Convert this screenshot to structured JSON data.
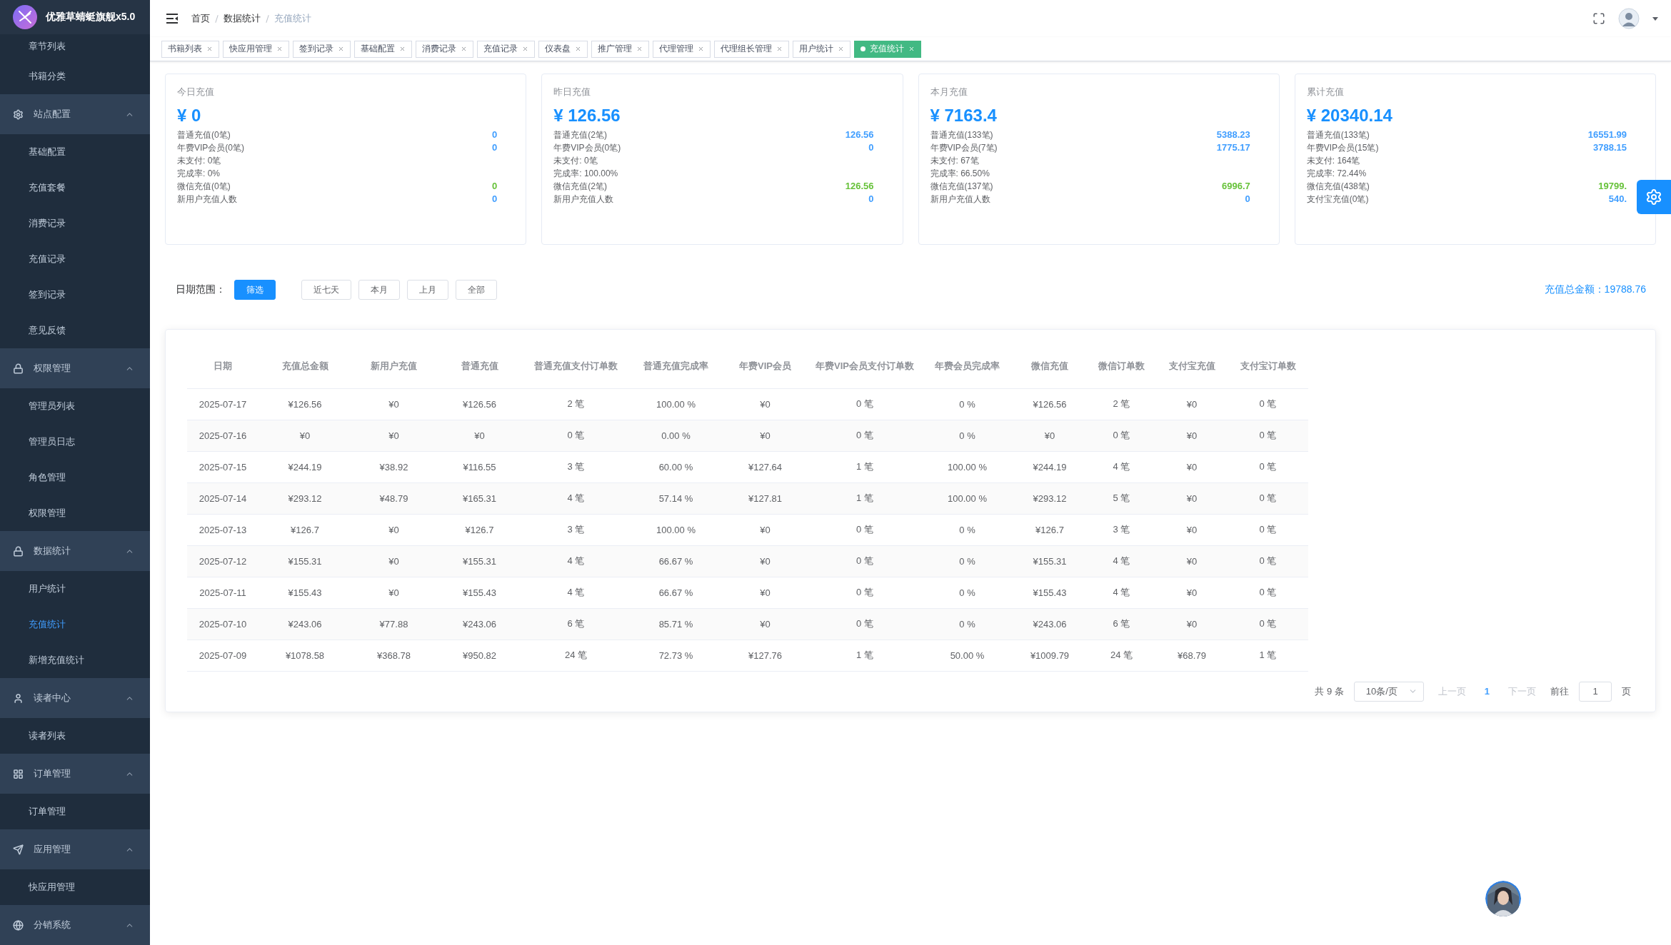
{
  "sidebar": {
    "logo_title": "优雅草蜻蜓旗舰x5.0",
    "menu": [
      {
        "kind": "item",
        "label": "章节列表",
        "selected": false
      },
      {
        "kind": "item",
        "label": "书籍分类",
        "selected": false
      },
      {
        "kind": "group",
        "label": "站点配置",
        "expanded": true,
        "children": [
          {
            "label": "基础配置",
            "selected": false
          },
          {
            "label": "充值套餐",
            "selected": false
          },
          {
            "label": "消费记录",
            "selected": false
          },
          {
            "label": "充值记录",
            "selected": false
          },
          {
            "label": "签到记录",
            "selected": false
          },
          {
            "label": "意见反馈",
            "selected": false
          }
        ]
      },
      {
        "kind": "group",
        "label": "权限管理",
        "expanded": true,
        "children": [
          {
            "label": "管理员列表",
            "selected": false
          },
          {
            "label": "管理员日志",
            "selected": false
          },
          {
            "label": "角色管理",
            "selected": false
          },
          {
            "label": "权限管理",
            "selected": false
          }
        ]
      },
      {
        "kind": "group",
        "label": "数据统计",
        "expanded": true,
        "children": [
          {
            "label": "用户统计",
            "selected": false
          },
          {
            "label": "充值统计",
            "selected": true
          },
          {
            "label": "新增充值统计",
            "selected": false
          }
        ]
      },
      {
        "kind": "group",
        "label": "读者中心",
        "expanded": true,
        "children": [
          {
            "label": "读者列表",
            "selected": false
          }
        ]
      },
      {
        "kind": "group",
        "label": "订单管理",
        "expanded": true,
        "children": [
          {
            "label": "订单管理",
            "selected": false
          }
        ]
      },
      {
        "kind": "group",
        "label": "应用管理",
        "expanded": true,
        "children": [
          {
            "label": "快应用管理",
            "selected": false
          }
        ]
      },
      {
        "kind": "group",
        "label": "分销系统",
        "expanded": true
      }
    ]
  },
  "breadcrumb": [
    {
      "label": "首页"
    },
    {
      "label": "数据统计"
    },
    {
      "label": "充值统计"
    }
  ],
  "tabs": [
    {
      "label": "书籍列表",
      "selected": false
    },
    {
      "label": "快应用管理",
      "selected": false
    },
    {
      "label": "签到记录",
      "selected": false
    },
    {
      "label": "基础配置",
      "selected": false
    },
    {
      "label": "消费记录",
      "selected": false
    },
    {
      "label": "充值记录",
      "selected": false
    },
    {
      "label": "仪表盘",
      "selected": false
    },
    {
      "label": "推广管理",
      "selected": false
    },
    {
      "label": "代理管理",
      "selected": false
    },
    {
      "label": "代理组长管理",
      "selected": false
    },
    {
      "label": "用户统计",
      "selected": false
    },
    {
      "label": "充值统计",
      "selected": true
    }
  ],
  "cards": [
    {
      "title": "今日充值",
      "amount": "¥ 0",
      "lines": [
        {
          "label": "普通充值(0笔)",
          "value": "0",
          "color": "#409eff"
        },
        {
          "label": "年费VIP会员(0笔)",
          "value": "0",
          "color": "#409eff"
        },
        {
          "label": "未支付: 0笔"
        },
        {
          "label": "完成率: 0%"
        },
        {
          "label": "微信充值(0笔)",
          "value": "0",
          "color": "#67c23a"
        },
        {
          "label": "新用户充值人数",
          "value": "0",
          "color": "#409eff"
        }
      ]
    },
    {
      "title": "昨日充值",
      "amount": "¥ 126.56",
      "lines": [
        {
          "label": "普通充值(2笔)",
          "value": "126.56",
          "color": "#409eff"
        },
        {
          "label": "年费VIP会员(0笔)",
          "value": "0",
          "color": "#409eff"
        },
        {
          "label": "未支付: 0笔"
        },
        {
          "label": "完成率: 100.00%"
        },
        {
          "label": "微信充值(2笔)",
          "value": "126.56",
          "color": "#67c23a"
        },
        {
          "label": "新用户充值人数",
          "value": "0",
          "color": "#409eff"
        }
      ]
    },
    {
      "title": "本月充值",
      "amount": "¥ 7163.4",
      "lines": [
        {
          "label": "普通充值(133笔)",
          "value": "5388.23",
          "color": "#409eff"
        },
        {
          "label": "年费VIP会员(7笔)",
          "value": "1775.17",
          "color": "#409eff"
        },
        {
          "label": "未支付: 67笔"
        },
        {
          "label": "完成率: 66.50%"
        },
        {
          "label": "微信充值(137笔)",
          "value": "6996.7",
          "color": "#67c23a"
        },
        {
          "label": "新用户充值人数",
          "value": "0",
          "color": "#409eff"
        }
      ]
    },
    {
      "title": "累计充值",
      "amount": "¥ 20340.14",
      "lines": [
        {
          "label": "普通充值(133笔)",
          "value": "16551.99",
          "color": "#409eff"
        },
        {
          "label": "年费VIP会员(15笔)",
          "value": "3788.15",
          "color": "#409eff"
        },
        {
          "label": "未支付: 164笔"
        },
        {
          "label": "完成率: 72.44%"
        },
        {
          "label": "微信充值(438笔)",
          "value": "19799.",
          "color": "#67c23a"
        },
        {
          "label": "支付宝充值(0笔)",
          "value": "540.",
          "color": "#409eff"
        }
      ]
    }
  ],
  "filter": {
    "label": "日期范围：",
    "buttons": [
      {
        "label": "筛选",
        "kind": "primary"
      },
      {
        "label": "近七天",
        "kind": "plain"
      },
      {
        "label": "本月",
        "kind": "plain"
      },
      {
        "label": "上月",
        "kind": "plain"
      },
      {
        "label": "全部",
        "kind": "plain"
      }
    ],
    "total": "充值总金额：19788.76"
  },
  "table": {
    "columns": [
      "日期",
      "充值总金额",
      "新用户充值",
      "普通充值",
      "普通充值支付订单数",
      "普通充值完成率",
      "年费VIP会员",
      "年费VIP会员支付订单数",
      "年费会员完成率",
      "微信充值",
      "微信订单数",
      "支付宝充值",
      "支付宝订单数"
    ],
    "rows": [
      [
        "2025-07-17",
        "¥126.56",
        "¥0",
        "¥126.56",
        "2 笔",
        "100.00 %",
        "¥0",
        "0 笔",
        "0 %",
        "¥126.56",
        "2 笔",
        "¥0",
        "0 笔"
      ],
      [
        "2025-07-16",
        "¥0",
        "¥0",
        "¥0",
        "0 笔",
        "0.00 %",
        "¥0",
        "0 笔",
        "0 %",
        "¥0",
        "0 笔",
        "¥0",
        "0 笔"
      ],
      [
        "2025-07-15",
        "¥244.19",
        "¥38.92",
        "¥116.55",
        "3 笔",
        "60.00 %",
        "¥127.64",
        "1 笔",
        "100.00 %",
        "¥244.19",
        "4 笔",
        "¥0",
        "0 笔"
      ],
      [
        "2025-07-14",
        "¥293.12",
        "¥48.79",
        "¥165.31",
        "4 笔",
        "57.14 %",
        "¥127.81",
        "1 笔",
        "100.00 %",
        "¥293.12",
        "5 笔",
        "¥0",
        "0 笔"
      ],
      [
        "2025-07-13",
        "¥126.7",
        "¥0",
        "¥126.7",
        "3 笔",
        "100.00 %",
        "¥0",
        "0 笔",
        "0 %",
        "¥126.7",
        "3 笔",
        "¥0",
        "0 笔"
      ],
      [
        "2025-07-12",
        "¥155.31",
        "¥0",
        "¥155.31",
        "4 笔",
        "66.67 %",
        "¥0",
        "0 笔",
        "0 %",
        "¥155.31",
        "4 笔",
        "¥0",
        "0 笔"
      ],
      [
        "2025-07-11",
        "¥155.43",
        "¥0",
        "¥155.43",
        "4 笔",
        "66.67 %",
        "¥0",
        "0 笔",
        "0 %",
        "¥155.43",
        "4 笔",
        "¥0",
        "0 笔"
      ],
      [
        "2025-07-10",
        "¥243.06",
        "¥77.88",
        "¥243.06",
        "6 笔",
        "85.71 %",
        "¥0",
        "0 笔",
        "0 %",
        "¥243.06",
        "6 笔",
        "¥0",
        "0 笔"
      ],
      [
        "2025-07-09",
        "¥1078.58",
        "¥368.78",
        "¥950.82",
        "24 笔",
        "72.73 %",
        "¥127.76",
        "1 笔",
        "50.00 %",
        "¥1009.79",
        "24 笔",
        "¥68.79",
        "1 笔"
      ]
    ]
  },
  "pagination": {
    "total": "共 9 条",
    "page_size": "10条/页",
    "prev": {
      "label": "上一页",
      "disabled": true
    },
    "pages": [
      {
        "label": "1",
        "selected": true
      }
    ],
    "next": {
      "label": "下一页",
      "disabled": true
    },
    "goto_label": "前往",
    "goto_value": "1",
    "goto_suffix": "页"
  }
}
